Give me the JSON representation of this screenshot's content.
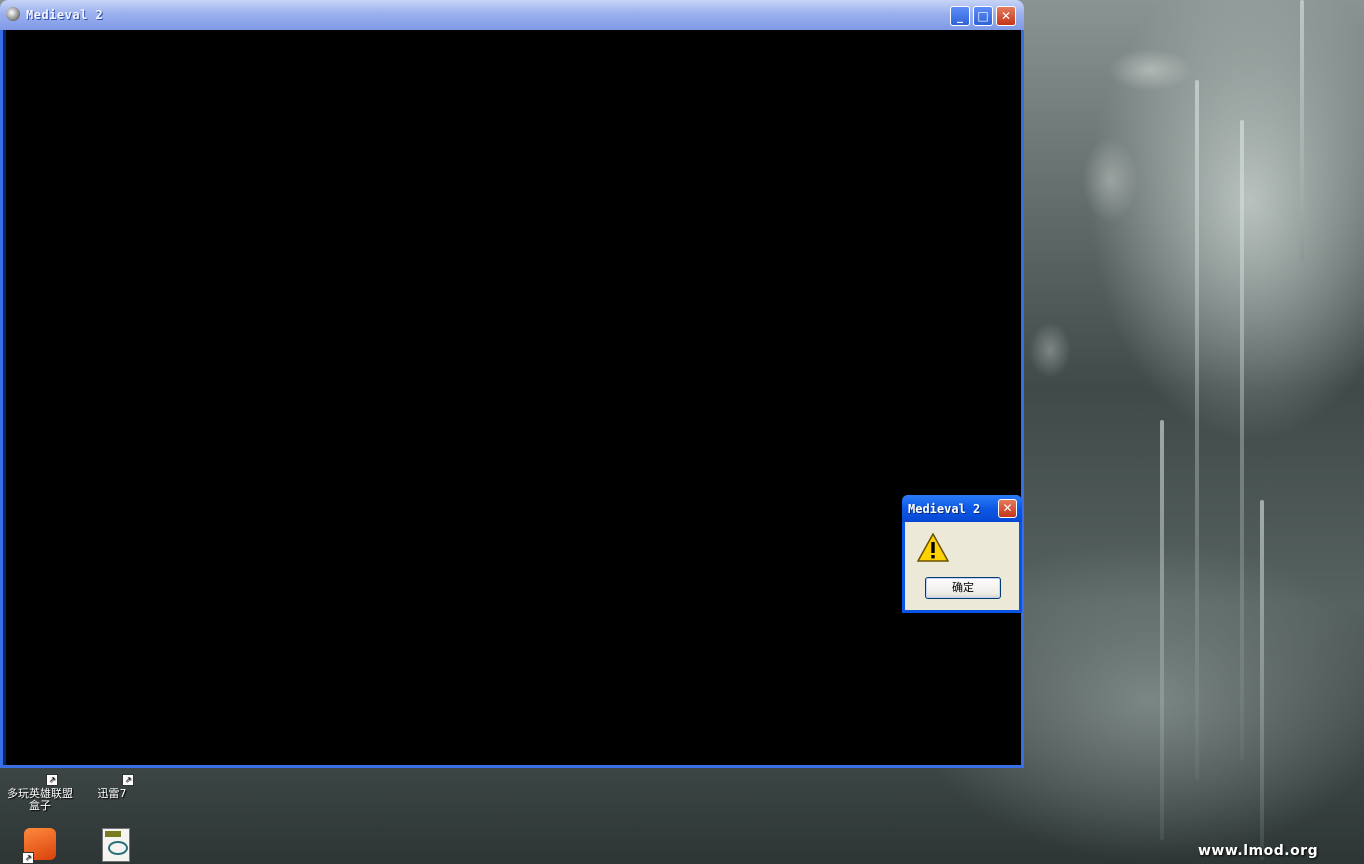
{
  "main_window": {
    "title": "Medieval 2",
    "minimize_label": "_",
    "maximize_label": "□",
    "close_label": "✕"
  },
  "dialog": {
    "title": "Medieval 2",
    "close_label": "✕",
    "icon": "warning-icon",
    "ok_label": "确定"
  },
  "desktop": {
    "icons": [
      {
        "label": "多玩英雄联盟\n盒子",
        "icon": "game-box-icon"
      },
      {
        "label": "迅雷7",
        "icon": "thunder-icon"
      },
      {
        "label": "",
        "icon": "app-shortcut-icon"
      },
      {
        "label": "",
        "icon": "document-icon"
      }
    ],
    "watermark": "www.lmod.org"
  },
  "colors": {
    "xp_blue": "#0a54e3",
    "inactive_title": "#9bb0ef",
    "client": "#000000"
  }
}
